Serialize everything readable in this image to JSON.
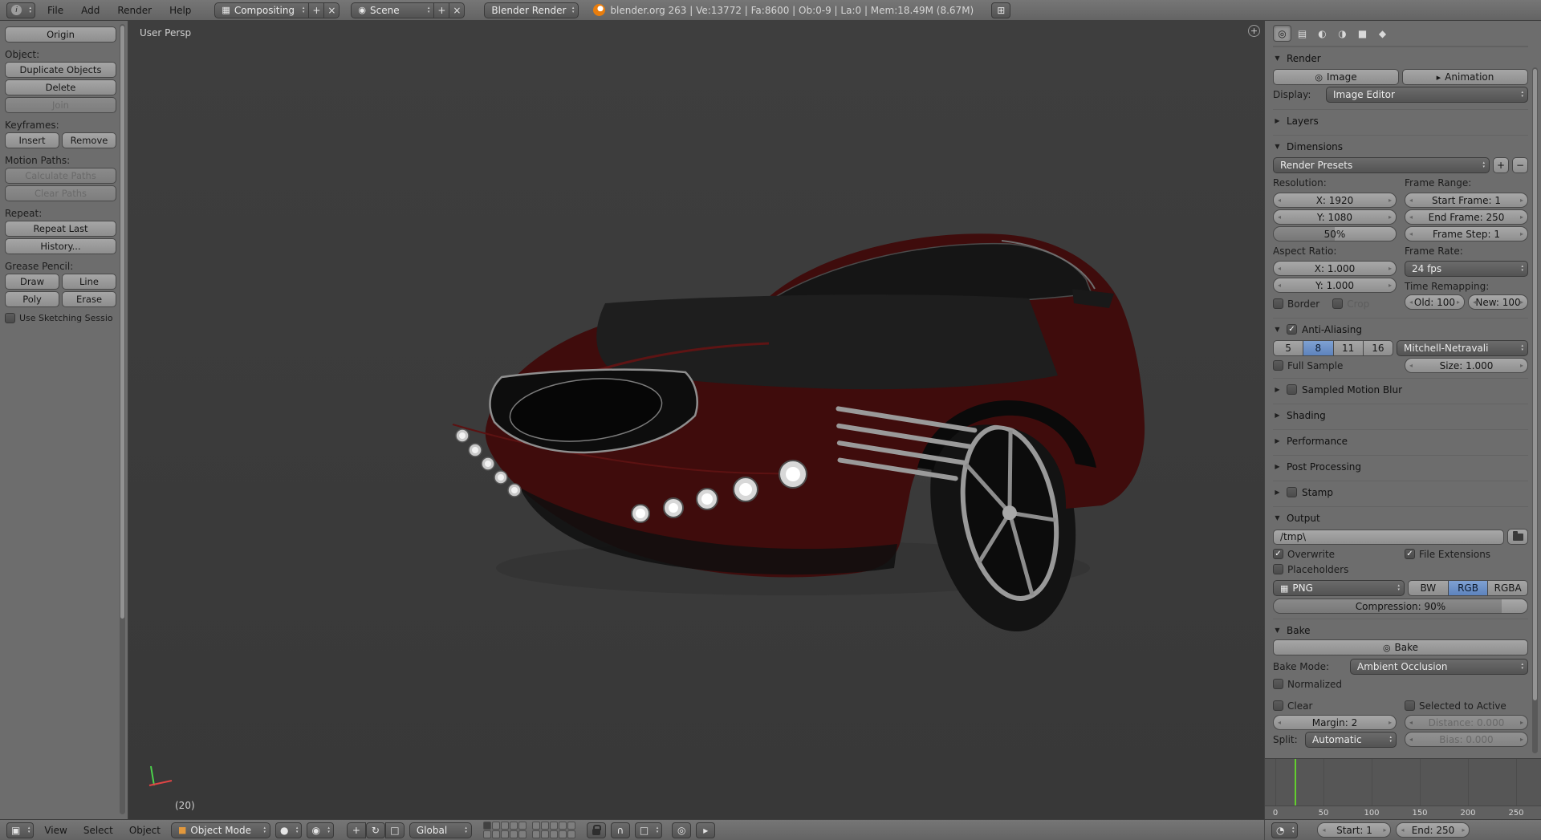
{
  "app": {
    "layout_name": "Compositing",
    "scene_name": "Scene",
    "engine": "Blender Render",
    "stats": "blender.org 263 | Ve:13772 | Fa:8600 | Ob:0-9 | La:0 | Mem:18.49M (8.67M)"
  },
  "top_menus": {
    "file": "File",
    "add": "Add",
    "render": "Render",
    "help": "Help"
  },
  "tool_shelf": {
    "origin": "Origin",
    "object_label": "Object:",
    "duplicate": "Duplicate Objects",
    "delete": "Delete",
    "join": "Join",
    "keyframes_label": "Keyframes:",
    "insert": "Insert",
    "remove": "Remove",
    "motion_label": "Motion Paths:",
    "calculate": "Calculate Paths",
    "clear": "Clear Paths",
    "repeat_label": "Repeat:",
    "repeat_last": "Repeat Last",
    "history": "History...",
    "grease_label": "Grease Pencil:",
    "draw": "Draw",
    "line": "Line",
    "poly": "Poly",
    "erase": "Erase",
    "sketching": "Use Sketching Sessio"
  },
  "viewport": {
    "view_name": "User Persp",
    "frame": "(20)",
    "expand": "+"
  },
  "props": {
    "tabs": [
      "◎",
      "▤",
      "◐",
      "◑",
      "■",
      "◆"
    ],
    "render": {
      "title": "Render",
      "image": "Image",
      "animation": "Animation",
      "display_label": "Display:",
      "display": "Image Editor"
    },
    "layers": {
      "title": "Layers"
    },
    "dims": {
      "title": "Dimensions",
      "presets": "Render Presets",
      "preset_add": "+",
      "preset_del": "−",
      "resolution_label": "Resolution:",
      "x": "X: 1920",
      "y": "Y: 1080",
      "pct": "50%",
      "range_label": "Frame Range:",
      "start": "Start Frame: 1",
      "end": "End Frame: 250",
      "step": "Frame Step: 1",
      "aspect_label": "Aspect Ratio:",
      "ax": "X: 1.000",
      "ay": "Y: 1.000",
      "rate_label": "Frame Rate:",
      "fps": "24 fps",
      "remap_label": "Time Remapping:",
      "old": "Old: 100",
      "new": "New: 100",
      "border": "Border",
      "crop": "Crop"
    },
    "aa": {
      "title": "Anti-Aliasing",
      "s5": "5",
      "s8": "8",
      "s11": "11",
      "s16": "16",
      "filter": "Mitchell-Netravali",
      "full": "Full Sample",
      "size": "Size: 1.000"
    },
    "collapsed": {
      "motion_blur": "Sampled Motion Blur",
      "shading": "Shading",
      "performance": "Performance",
      "post": "Post Processing",
      "stamp": "Stamp"
    },
    "output": {
      "title": "Output",
      "path": "/tmp\\",
      "overwrite": "Overwrite",
      "ext": "File Extensions",
      "placeholders": "Placeholders",
      "format": "PNG",
      "bw": "BW",
      "rgb": "RGB",
      "rgba": "RGBA",
      "compression": "Compression: 90%"
    },
    "bake": {
      "title": "Bake",
      "bake": "Bake",
      "mode_label": "Bake Mode:",
      "mode": "Ambient Occlusion",
      "normalized": "Normalized",
      "clear": "Clear",
      "sel": "Selected to Active",
      "margin": "Margin: 2",
      "distance": "Distance: 0.000",
      "split_label": "Split:",
      "split": "Automatic",
      "bias": "Bias: 0.000"
    }
  },
  "timeline": {
    "t0": "0",
    "t1": "50",
    "t2": "100",
    "t3": "150",
    "t4": "200",
    "t5": "250",
    "current_frame": 20,
    "start": "Start: 1",
    "end": "End: 250"
  },
  "bottom": {
    "view": "View",
    "select": "Select",
    "object": "Object",
    "mode": "Object Mode",
    "orientation": "Global"
  },
  "icons": {
    "info": "i",
    "screen": "▦",
    "scene": "◉",
    "plus": "+",
    "close": "×",
    "window": "⊞",
    "image_btn": "◎",
    "anim_btn": "▸",
    "png": "▦",
    "bake_btn": "◎",
    "editor_3d": "▣",
    "mode_cube": "■",
    "sphere": "●",
    "pivot": "◉",
    "manip_translate": "+",
    "manip_rotate": "↻",
    "manip_scale": "□",
    "magnet": "∩",
    "snap_element": "□",
    "render_still": "◎",
    "render_anim": "▸",
    "timeline_editor": "◔"
  }
}
